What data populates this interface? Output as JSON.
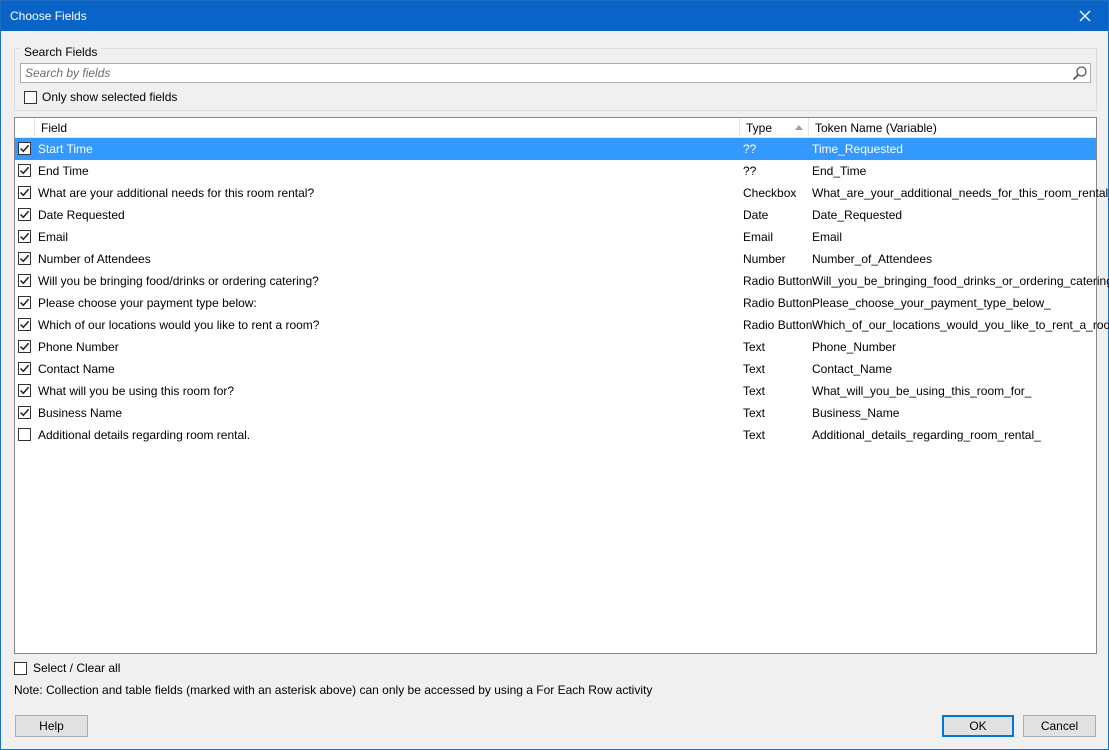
{
  "window": {
    "title": "Choose Fields"
  },
  "search": {
    "group_label": "Search Fields",
    "placeholder": "Search by fields",
    "value": "",
    "only_show_selected": {
      "label": "Only show selected fields",
      "checked": false
    }
  },
  "grid": {
    "columns": [
      {
        "label": "Field"
      },
      {
        "label": "Type",
        "sorted": "ascending"
      },
      {
        "label": "Token Name (Variable)"
      }
    ],
    "rows": [
      {
        "checked": true,
        "field": "Start Time",
        "type": "??",
        "token": "Time_Requested",
        "selected": true
      },
      {
        "checked": true,
        "field": "End Time",
        "type": "??",
        "token": "End_Time"
      },
      {
        "checked": true,
        "field": "What are your additional needs for this room rental?",
        "type": "Checkbox",
        "token": "What_are_your_additional_needs_for_this_room_rental_"
      },
      {
        "checked": true,
        "field": "Date Requested",
        "type": "Date",
        "token": "Date_Requested"
      },
      {
        "checked": true,
        "field": "Email",
        "type": "Email",
        "token": "Email"
      },
      {
        "checked": true,
        "field": "Number of Attendees",
        "type": "Number",
        "token": "Number_of_Attendees"
      },
      {
        "checked": true,
        "field": "Will you be bringing food/drinks or ordering catering?",
        "type": "Radio Button",
        "token": "Will_you_be_bringing_food_drinks_or_ordering_catering_"
      },
      {
        "checked": true,
        "field": "Please choose your payment type below:",
        "type": "Radio Button",
        "token": "Please_choose_your_payment_type_below_"
      },
      {
        "checked": true,
        "field": "Which of our locations would you like to rent a room?",
        "type": "Radio Button",
        "token": "Which_of_our_locations_would_you_like_to_rent_a_room_"
      },
      {
        "checked": true,
        "field": "Phone Number",
        "type": "Text",
        "token": "Phone_Number"
      },
      {
        "checked": true,
        "field": "Contact Name",
        "type": "Text",
        "token": "Contact_Name"
      },
      {
        "checked": true,
        "field": "What will you be using this room for?",
        "type": "Text",
        "token": "What_will_you_be_using_this_room_for_"
      },
      {
        "checked": true,
        "field": "Business Name",
        "type": "Text",
        "token": "Business_Name"
      },
      {
        "checked": false,
        "field": "Additional details regarding room rental.",
        "type": "Text",
        "token": "Additional_details_regarding_room_rental_"
      }
    ]
  },
  "footer": {
    "select_all": {
      "label": "Select / Clear all",
      "checked": false
    },
    "note": "Note: Collection and table fields (marked with an asterisk above) can only be accessed by using a For Each Row activity"
  },
  "buttons": {
    "help": "Help",
    "ok": "OK",
    "cancel": "Cancel"
  },
  "colors": {
    "titlebar": "#0a64c8",
    "selection": "#3399ff",
    "focus_border": "#0078d7"
  }
}
